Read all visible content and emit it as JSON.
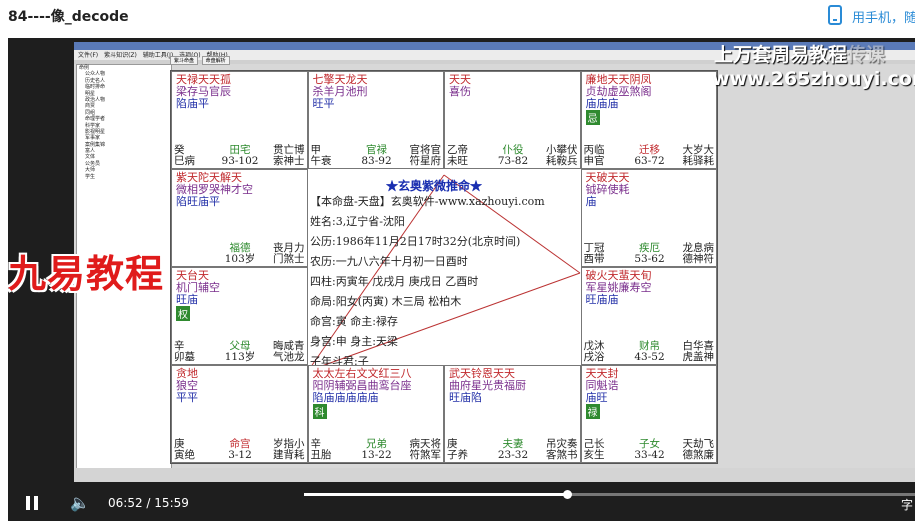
{
  "header": {
    "title": "84----像_decode",
    "mobile_label": "用手机，随"
  },
  "watermarks": {
    "line1": "上万套周易教程",
    "line1_faint": "传课",
    "line2": "www.265zhouyi.com",
    "jiuyi": "九易教程"
  },
  "app": {
    "menu": [
      "文件(F)",
      "紫斗知识(Z)",
      "辅助工具(J)",
      "选项(O)",
      "帮助(H)"
    ],
    "tabs": [
      "紫斗命盘",
      "命盘解析"
    ],
    "tree": [
      "命例",
      "公众人物",
      "历史名人",
      "临时排命",
      "明星",
      "政治人物",
      "商贾",
      "同组",
      "命理学者",
      "科学家",
      "影视明星",
      "军事家",
      "案例集锦",
      "富人",
      "文体",
      "公务员",
      "大师",
      "学生"
    ]
  },
  "palaces": [
    {
      "r1": "天禄天天孤",
      "r2": "梁存马官辰",
      "r3": "陷庙平",
      "badge": "",
      "bl1": "癸",
      "bl2": "巳病",
      "pal": "田宅",
      "age": "93-102",
      "br1": "贯亡博",
      "br2": "索神士",
      "red": false
    },
    {
      "r1": "七擎天龙天",
      "r2": "杀羊月池刑",
      "r3": "旺平",
      "badge": "",
      "bl1": "甲",
      "bl2": "午衰",
      "pal": "官禄",
      "age": "83-92",
      "br1": "官将官",
      "br2": "符星府",
      "red": false
    },
    {
      "r1": "天天",
      "r2": "喜伤",
      "r3": "",
      "badge": "",
      "bl1": "乙帝",
      "bl2": "未旺",
      "pal": "仆役",
      "age": "73-82",
      "br1": "小攀伏",
      "br2": "耗鞍兵",
      "red": false
    },
    {
      "r1": "廉地天天阴凤",
      "r2": "贞劫虚巫煞阁",
      "r3": "庙庙庙",
      "badge": "忌",
      "bl1": "丙临",
      "bl2": "申官",
      "pal": "迁移",
      "age": "63-72",
      "br1": "大岁大",
      "br2": "耗驿耗",
      "red": true
    },
    {
      "r1": "紫天陀天解天",
      "r2": "微相罗哭神才空",
      "r3": "陷旺庙平",
      "badge": "",
      "bl1": "",
      "bl2": "",
      "pal": "福德",
      "age": "103岁",
      "br1": "丧月力",
      "br2": "门煞士",
      "red": false
    },
    {
      "r1": "天破天天",
      "r2": "钺碎使耗",
      "r3": "庙",
      "badge": "",
      "bl1": "丁冠",
      "bl2": "酉带",
      "pal": "疾厄",
      "age": "53-62",
      "br1": "龙息病",
      "br2": "德神符",
      "red": false
    },
    {
      "r1": "天台天",
      "r2": "机门辅空",
      "r3": "旺庙",
      "badge": "权",
      "bl1": "辛",
      "bl2": "卯墓",
      "pal": "父母",
      "age": "113岁",
      "br1": "晦咸青",
      "br2": "气池龙",
      "red": false
    },
    {
      "r1": "破火天蜚天旬",
      "r2": "军星姚廉寿空",
      "r3": "旺庙庙",
      "badge": "",
      "bl1": "戊沐",
      "bl2": "戌浴",
      "pal": "财帛",
      "age": "43-52",
      "br1": "白华喜",
      "br2": "虎盖神",
      "red": false
    },
    {
      "r1": "贪地",
      "r2": "狼空",
      "r3": "平平",
      "badge": "",
      "bl1": "庚",
      "bl2": "寅绝",
      "pal": "命宫",
      "age": "3-12",
      "br1": "岁指小",
      "br2": "建背耗",
      "red": true
    },
    {
      "r1": "太太左右文文红三八",
      "r2": "阳阴辅弼昌曲鸾台座",
      "r3": "陷庙庙庙庙庙",
      "badge": "科",
      "bl1": "辛",
      "bl2": "丑胎",
      "pal": "兄弟",
      "age": "13-22",
      "br1": "病天将",
      "br2": "符煞军",
      "red": false
    },
    {
      "r1": "武天铃恩天天",
      "r2": "曲府星光贵福厨",
      "r3": "旺庙陷",
      "badge": "",
      "bl1": "庚",
      "bl2": "子养",
      "pal": "夫妻",
      "age": "23-32",
      "br1": "吊灾奏",
      "br2": "客煞书",
      "red": false
    },
    {
      "r1": "天天封",
      "r2": "同魁诰",
      "r3": "庙旺",
      "badge": "禄",
      "bl1": "己长",
      "bl2": "亥生",
      "pal": "子女",
      "age": "33-42",
      "br1": "天劫飞",
      "br2": "德煞廉",
      "red": false
    }
  ],
  "center": {
    "title": "★玄奥紫微推命★",
    "line1": "【本命盘-天盘】玄奥软件-www.xazhouyi.com",
    "line2": "姓名:3,辽宁省-沈阳",
    "line3": "公历:1986年11月2日17时32分(北京时间)",
    "line4": "农历:一九八六年十月初一日酉时",
    "line5": "四柱:丙寅年 戊戌月 庚戌日 乙酉时",
    "line6": "命局:阳女(丙寅)  木三局 松柏木",
    "line7": "命宫:寅      命主:禄存",
    "line8": "身宫:申      身主:天梁",
    "line9": "子年斗君:子"
  },
  "player": {
    "current_time": "06:52",
    "separator": "/",
    "total_time": "15:59",
    "progress": 0.43,
    "subtitle_btn": "字"
  },
  "colors": {
    "accent": "#2a8bd6",
    "red": "#c0282c",
    "purple": "#7a2e8c",
    "blue": "#2431a8",
    "green": "#2e8a2e"
  }
}
